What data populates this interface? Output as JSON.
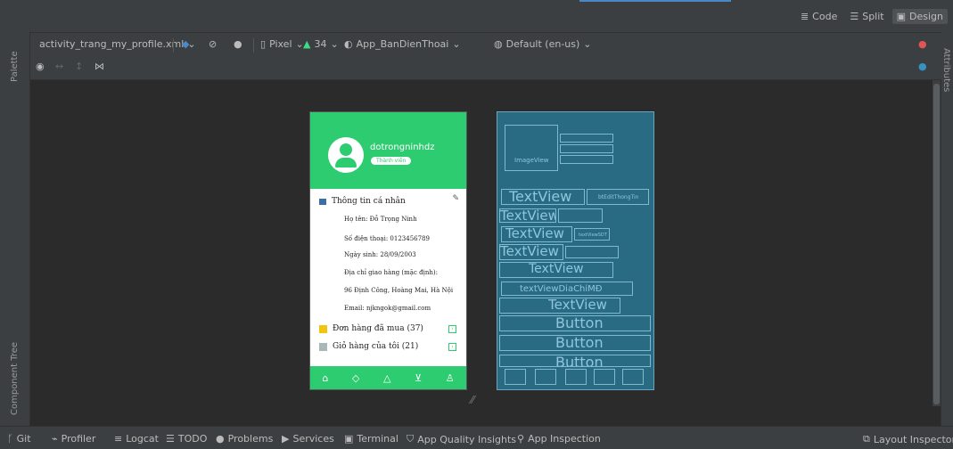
{
  "view_modes": {
    "code": "Code",
    "split": "Split",
    "design": "Design"
  },
  "toolbar": {
    "file": "activity_trang_my_profile.xml",
    "device": "Pixel",
    "api": "34",
    "theme": "App_BanDienThoai",
    "locale": "Default (en-us)"
  },
  "side": {
    "palette": "Palette",
    "component_tree": "Component Tree",
    "attributes": "Attributes"
  },
  "phone": {
    "username": "dotrongninhdz",
    "badge": "Thành viên",
    "section_title": "Thông tin cá nhân",
    "info": [
      "Họ tên: Đỗ Trọng Ninh",
      "Số điện thoại: 0123456789",
      "Ngày sinh: 28/09/2003",
      "Địa chỉ giao hàng (mặc định):",
      "96 Định Công, Hoàng Mai, Hà Nội",
      "Email: njkngok@gmail.com"
    ],
    "orders": [
      "Đơn hàng đã mua (37)",
      "Giỏ hàng của tôi (21)"
    ]
  },
  "blueprint": {
    "imageview": "ImageView",
    "textview": "TextView",
    "btn_edit": "btEditThongTin",
    "tv_sdt": "textViewSDT",
    "tv_diachi": "textViewDiaChiMĐ",
    "button": "Button"
  },
  "statusbar": {
    "git": "Git",
    "profiler": "Profiler",
    "logcat": "Logcat",
    "todo": "TODO",
    "problems": "Problems",
    "services": "Services",
    "terminal": "Terminal",
    "aqi": "App Quality Insights",
    "app_inspection": "App Inspection",
    "layout_inspector": "Layout Inspector"
  },
  "colors": {
    "accent_green": "#2ecc71",
    "blueprint": "#2a6b84",
    "error": "#e05555",
    "help": "#3592c4"
  }
}
